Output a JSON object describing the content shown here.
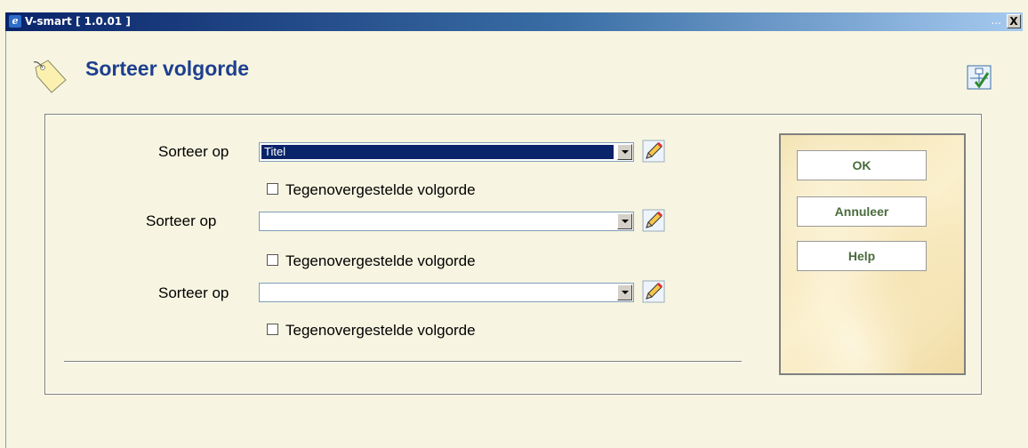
{
  "window": {
    "title": "V-smart [ 1.0.01 ]",
    "ellipsis": "...",
    "close_label": "X"
  },
  "header": {
    "title": "Sorteer volgorde"
  },
  "form": {
    "rows": [
      {
        "label": "Sorteer op",
        "value": "Titel",
        "checkbox_label": "Tegenovergestelde volgorde",
        "checked": false
      },
      {
        "label": "Sorteer op",
        "value": "",
        "checkbox_label": "Tegenovergestelde volgorde",
        "checked": false
      },
      {
        "label": "Sorteer op",
        "value": "",
        "checkbox_label": "Tegenovergestelde volgorde",
        "checked": false
      }
    ]
  },
  "buttons": {
    "ok": "OK",
    "cancel": "Annuleer",
    "help": "Help"
  },
  "colors": {
    "title": "#1d3f8f",
    "button_text": "#4a6b3d",
    "background": "#f7f5e1",
    "selection": "#0a246a"
  },
  "icons": {
    "header": "tag-icon",
    "tool": "tree-check-icon",
    "edit": "pencil-icon"
  }
}
